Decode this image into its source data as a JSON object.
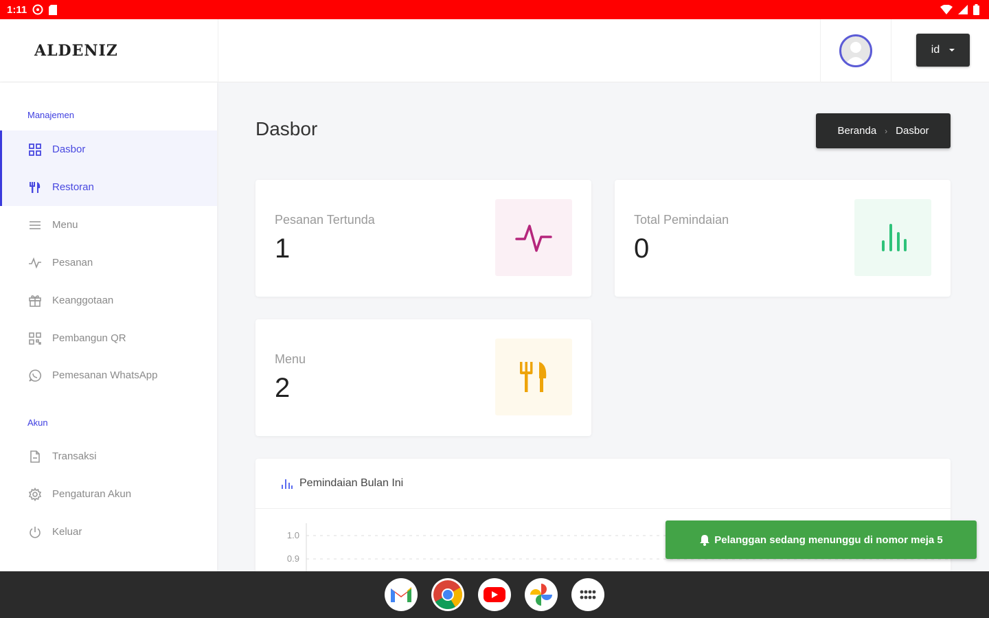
{
  "status_bar": {
    "time": "1:11"
  },
  "header": {
    "brand": "ALDENIZ",
    "language": "id"
  },
  "sidebar": {
    "sections": [
      {
        "title": "Manajemen"
      },
      {
        "title": "Akun"
      }
    ],
    "items": [
      {
        "label": "Dasbor",
        "icon": "dashboard-grid-icon"
      },
      {
        "label": "Restoran",
        "icon": "utensils-icon"
      },
      {
        "label": "Menu",
        "icon": "list-icon"
      },
      {
        "label": "Pesanan",
        "icon": "activity-icon"
      },
      {
        "label": "Keanggotaan",
        "icon": "gift-icon"
      },
      {
        "label": "Pembangun QR",
        "icon": "qr-icon"
      },
      {
        "label": "Pemesanan WhatsApp",
        "icon": "whatsapp-icon"
      },
      {
        "label": "Transaksi",
        "icon": "document-icon"
      },
      {
        "label": "Pengaturan Akun",
        "icon": "gear-icon"
      },
      {
        "label": "Keluar",
        "icon": "power-icon"
      }
    ]
  },
  "main": {
    "title": "Dasbor",
    "breadcrumb": [
      "Beranda",
      "Dasbor"
    ],
    "stats": [
      {
        "label": "Pesanan Tertunda",
        "value": "1",
        "icon": "activity-icon",
        "color": "#b5267c",
        "bg": "#fbf0f5"
      },
      {
        "label": "Total Pemindaian",
        "value": "0",
        "icon": "bar-chart-icon",
        "color": "#2fc27a",
        "bg": "#eefaf3"
      },
      {
        "label": "Menu",
        "value": "2",
        "icon": "utensils-icon",
        "color": "#eea40a",
        "bg": "#fef9ec"
      }
    ],
    "chart_title": "Pemindaian Bulan Ini"
  },
  "chart_data": {
    "type": "line",
    "title": "Pemindaian Bulan Ini",
    "y_ticks": [
      "1.0",
      "0.9"
    ],
    "ylim": [
      0,
      1.0
    ],
    "grid": true
  },
  "toast": {
    "message": "Pelanggan sedang menunggu di nomor meja 5"
  },
  "taskbar": {
    "apps": [
      "gmail-icon",
      "chrome-icon",
      "youtube-icon",
      "photos-icon",
      "app-launcher-icon"
    ]
  },
  "colors": {
    "accent": "#3b3bdc",
    "status_bar": "#ff0000",
    "toast": "#43a447"
  }
}
